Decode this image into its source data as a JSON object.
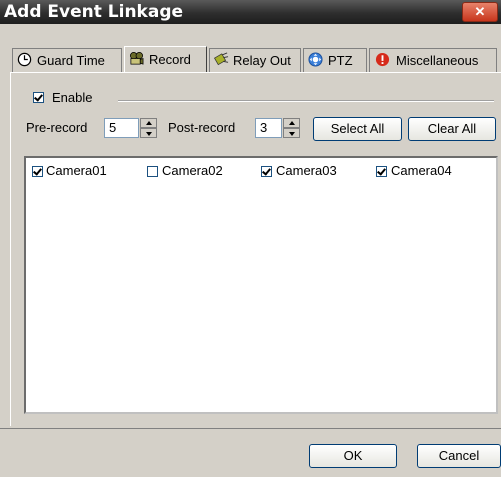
{
  "window": {
    "title": "Add Event Linkage",
    "close_label": "✕"
  },
  "tabs": [
    {
      "label": "Guard Time",
      "icon": "clock-icon",
      "active": false
    },
    {
      "label": "Record",
      "icon": "video-camera-icon",
      "active": true
    },
    {
      "label": "Relay Out",
      "icon": "relay-icon",
      "active": false
    },
    {
      "label": "PTZ",
      "icon": "ptz-icon",
      "active": false
    },
    {
      "label": "Miscellaneous",
      "icon": "alert-icon",
      "active": false
    }
  ],
  "enable": {
    "label": "Enable",
    "checked": true
  },
  "prerecord": {
    "label": "Pre-record",
    "value": "5"
  },
  "postrecord": {
    "label": "Post-record",
    "value": "3"
  },
  "buttons": {
    "select_all": "Select All",
    "clear_all": "Clear All",
    "ok": "OK",
    "cancel": "Cancel"
  },
  "cameras": [
    {
      "label": "Camera01",
      "checked": true
    },
    {
      "label": "Camera02",
      "checked": false
    },
    {
      "label": "Camera03",
      "checked": true
    },
    {
      "label": "Camera04",
      "checked": true
    }
  ],
  "colors": {
    "title_bar": "#2e2e2e",
    "window_bg": "#d4d0c8",
    "close_button": "#c8361d"
  }
}
